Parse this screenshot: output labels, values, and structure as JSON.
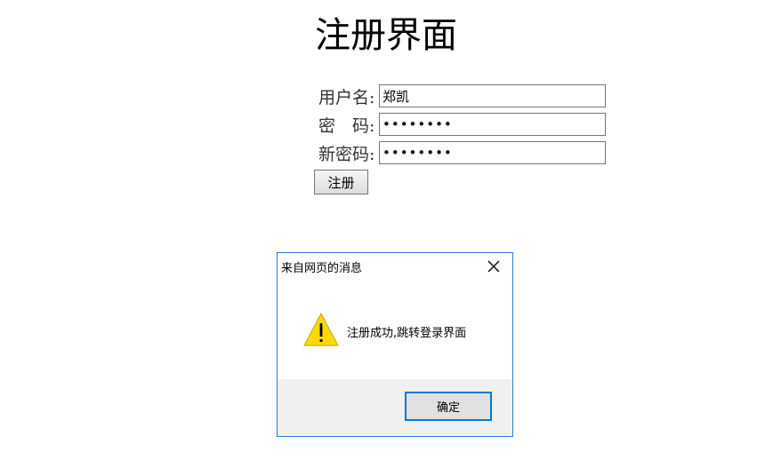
{
  "page": {
    "title": "注册界面"
  },
  "form": {
    "fields": [
      {
        "label": "用户名:",
        "value": "郑凯",
        "type": "text"
      },
      {
        "label": "密　码:",
        "value": "••••••••",
        "type": "password"
      },
      {
        "label": "新密码:",
        "value": "••••••••",
        "type": "password"
      }
    ],
    "submit_label": "注册"
  },
  "dialog": {
    "title": "来自网页的消息",
    "message": "注册成功,跳转登录界面",
    "ok_label": "确定",
    "icons": {
      "close": "close-icon",
      "warning": "warning-icon"
    },
    "colors": {
      "border": "#2b7cd3",
      "footer_bg": "#f0f0f0",
      "ok_border": "#0078d7",
      "warning_fill": "#ffd800"
    }
  }
}
